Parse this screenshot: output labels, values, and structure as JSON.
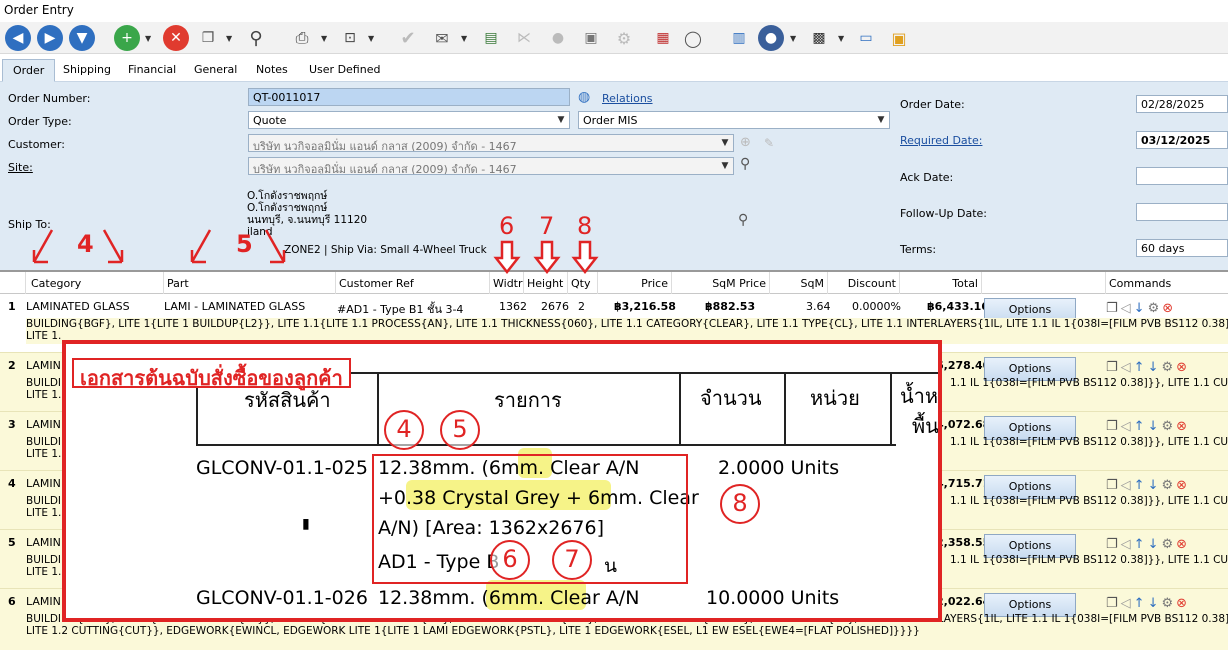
{
  "window": {
    "title": "Order Entry"
  },
  "tabs": [
    "Order",
    "Shipping",
    "Financial",
    "General",
    "Notes",
    "User Defined"
  ],
  "form": {
    "order_number_label": "Order Number:",
    "order_number": "QT-0011017",
    "relations": "Relations",
    "order_type_label": "Order Type:",
    "order_type": "Quote",
    "order_type2": "Order MIS",
    "customer_label": "Customer:",
    "customer": "บริษัท นวกิจอลูมินั่ม แอนด์ กลาส (2009) จำกัด - 1467",
    "site_label": "Site:",
    "site": "บริษัท นวกิจอลูมินั่ม แอนด์ กลาส (2009) จำกัด - 1467",
    "ship_to_label": "Ship To:",
    "ship_lines": [
      "O.โกดังราชพฤกษ์",
      "O.โกดังราชพฤกษ์",
      "นนทบุรี, จ.นนทบุรี 11120",
      "iland"
    ],
    "ship_via": "ZONE2  |  Ship Via: Small 4-Wheel Truck",
    "order_date_label": "Order Date:",
    "order_date": "02/28/2025",
    "required_date_label": "Required Date:",
    "required_date": "03/12/2025",
    "ack_date_label": "Ack Date:",
    "followup_label": "Follow-Up Date:",
    "terms_label": "Terms:",
    "terms": "60 days"
  },
  "grid": {
    "headers": [
      "Category",
      "Part",
      "Customer Ref",
      "Widtr",
      "Height",
      "Qty",
      "Price",
      "SqM Price",
      "SqM",
      "Discount",
      "Total",
      "Commands"
    ],
    "rows": [
      {
        "num": "1",
        "category": "LAMINATED GLASS",
        "part": "LAMI - LAMINATED GLASS",
        "ref": "#AD1 - Type B1 ชั้น 3-4",
        "width": "1362",
        "height": "2676",
        "qty": "2",
        "price": "฿3,216.58",
        "sqm_price": "฿882.53",
        "sqm": "3.64",
        "discount": "0.0000%",
        "total": "฿6,433.16",
        "desc": "BUILDING{BGF}, LITE 1{LITE 1 BUILDUP{L2}}, LITE 1.1{LITE 1.1 PROCESS{AN}, LITE 1.1 THICKNESS{060}, LITE 1.1 CATEGORY{CLEAR}, LITE 1.1 TYPE{CL}, LITE 1.1 INTERLAYERS{1IL, LITE 1.1 IL 1{038I=[FILM PVB BS112 0.38]}}, LITE 1.1 CUTTIN",
        "desc2": "LITE 1."
      },
      {
        "num": "2",
        "category": "LAMIN",
        "total": "6,278.40",
        "desc": "BUILDI",
        "desc_right": "1.1 IL 1{038I=[FILM PVB BS112 0.38]}}, LITE 1.1 CUTTIN",
        "desc2": "LITE 1."
      },
      {
        "num": "3",
        "category": "LAMIN",
        "total": "4,072.68",
        "desc": "BUILDI",
        "desc_right": "1.1 IL 1{038I=[FILM PVB BS112 0.38]}}, LITE 1.1 CUTTIN",
        "desc2": "LITE 1."
      },
      {
        "num": "4",
        "category": "LAMIN",
        "total": "4,715.71",
        "desc": "BUILDI",
        "desc_right": "1.1 IL 1{038I=[FILM PVB BS112 0.38]}}, LITE 1.1 CUTTIN",
        "desc2": "LITE 1."
      },
      {
        "num": "5",
        "category": "LAMIN",
        "total": "2,358.55",
        "desc": "BUILDI",
        "desc_right": "1.1 IL 1{038I=[FILM PVB BS112 0.38]}}, LITE 1.1 CUTTIN",
        "desc2": "LITE 1."
      },
      {
        "num": "6",
        "category": "LAMIN",
        "total": "2,022.64",
        "desc": "BUILDING{BGF}, LITE 1{LITE 1 BUILDUP{L2}}, LITE 1.1{LITE 1.1 PROCESS{AN}, LITE 1.1 THICKNESS{060}, LITE 1.1 CATEGORY{CLEAR}, LITE 1.1 TYPE{CL}, LITE 1.1 INTERLAYERS{1IL, LITE 1.1 IL 1{038I=[FILM PVB BS112 0.38]}}, LITE 1.1 CUTTIN",
        "desc2": "LITE 1.2 CUTTING{CUT}}, EDGEWORK{EWINCL, EDGEWORK LITE 1{LITE 1 LAMI EDGEWORK{PSTL}, LITE 1 EDGEWORK{ESEL, L1 EW ESEL{EWE4=[FLAT POLISHED]}}}}"
      }
    ],
    "options_label": "Options"
  },
  "overlay": {
    "title": "เอกสารต้นฉบับสั่งซื้อของลูกค้า",
    "col_code": "รหัสสินค้า",
    "col_item": "รายการ",
    "col_qty": "จำนวน",
    "col_unit": "หน่วย",
    "col_weight": "น้ำห",
    "col_weight2": "พื้น",
    "code1": "GLCONV-01.1-025",
    "line1": "12.38mm. (6mm. Clear A/N",
    "line2": "+0.38 Crystal Grey + 6mm. Clear",
    "line3": "A/N) [Area: 1362x2676]",
    "line4": "AD1 - Type B",
    "line4b": "น",
    "qty1": "2.0000 Units",
    "code2": "GLCONV-01.1-026",
    "line5": "12.38mm. (6mm. Clear A/N",
    "qty2": "10.0000 Units"
  },
  "annotations": {
    "n4": "4",
    "n5": "5",
    "n6": "6",
    "n7": "7",
    "n8": "8"
  }
}
